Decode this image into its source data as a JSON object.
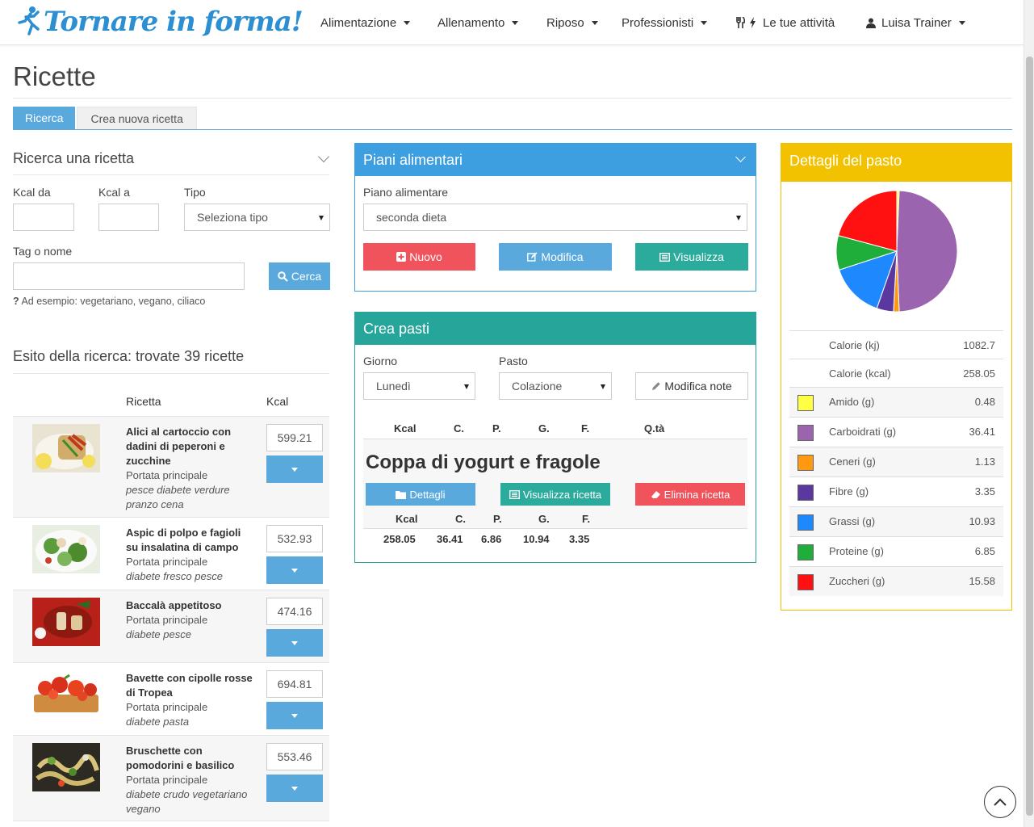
{
  "brand": {
    "name": "Tornare in forma!",
    "color": "#2b8fd2"
  },
  "nav": {
    "alimentazione": "Alimentazione",
    "allenamento": "Allenamento",
    "riposo": "Riposo",
    "professionisti": "Professionisti",
    "attivita": "Le tue attività",
    "user": "Luisa Trainer"
  },
  "page": {
    "title": "Ricette"
  },
  "tabs": {
    "search": "Ricerca",
    "create": "Crea nuova ricetta"
  },
  "search": {
    "heading": "Ricerca una ricetta",
    "kcal_from_label": "Kcal da",
    "kcal_to_label": "Kcal a",
    "type_label": "Tipo",
    "type_value": "Seleziona tipo",
    "tag_label": "Tag o nome",
    "search_button": "Cerca",
    "hint": "Ad esempio: vegetariano, vegano, ciliaco"
  },
  "results": {
    "heading": "Esito della ricerca: trovate 39 ricette",
    "col_recipe": "Ricetta",
    "col_kcal": "Kcal",
    "items": [
      {
        "title": "Alici al cartoccio con dadini di peperoni e zucchine",
        "course": "Portata principale",
        "tags": "pesce diabete verdure pranzo cena",
        "kcal": "599.21"
      },
      {
        "title": "Aspic di polpo e fagioli su insalatina di campo",
        "course": "Portata principale",
        "tags": "diabete fresco pesce",
        "kcal": "532.93"
      },
      {
        "title": "Baccalà appetitoso",
        "course": "Portata principale",
        "tags": "diabete pesce",
        "kcal": "474.16"
      },
      {
        "title": "Bavette con cipolle rosse di Tropea",
        "course": "Portata principale",
        "tags": "diabete pasta",
        "kcal": "694.81"
      },
      {
        "title": "Bruschette con pomodorini e basilico",
        "course": "Portata principale",
        "tags": "diabete crudo vegetariano vegano",
        "kcal": "553.46"
      }
    ]
  },
  "plans": {
    "heading": "Piani alimentari",
    "label": "Piano alimentare",
    "selected": "seconda dieta",
    "btn_new": "Nuovo",
    "btn_edit": "Modifica",
    "btn_view": "Visualizza",
    "color_head": "#3d9ee0"
  },
  "meals": {
    "heading": "Crea pasti",
    "day_label": "Giorno",
    "day_value": "Lunedì",
    "meal_label": "Pasto",
    "meal_value": "Colazione",
    "edit_notes": "Modifica note",
    "cols": [
      "Kcal",
      "C.",
      "P.",
      "G.",
      "F.",
      "Q.tà"
    ],
    "meal_name": "Coppa di yogurt e fragole",
    "btn_details": "Dettagli",
    "btn_view_recipe": "Visualizza ricetta",
    "btn_delete": "Elimina ricetta",
    "sub_cols": [
      "Kcal",
      "C.",
      "P.",
      "G.",
      "F."
    ],
    "values": [
      "258.05",
      "36.41",
      "6.86",
      "10.94",
      "3.35"
    ],
    "color_head": "#26a69a"
  },
  "details": {
    "heading": "Dettagli del pasto",
    "color_head": "#f2c200",
    "rows": [
      {
        "label": "Calorie (kj)",
        "value": "1082.7",
        "color": null
      },
      {
        "label": "Calorie (kcal)",
        "value": "258.05",
        "color": null
      },
      {
        "label": "Amido (g)",
        "value": "0.48",
        "color": "#ffff44"
      },
      {
        "label": "Carboidrati (g)",
        "value": "36.41",
        "color": "#9b64ae"
      },
      {
        "label": "Ceneri (g)",
        "value": "1.13",
        "color": "#ff9911"
      },
      {
        "label": "Fibre (g)",
        "value": "3.35",
        "color": "#5b37a0"
      },
      {
        "label": "Grassi (g)",
        "value": "10.93",
        "color": "#1e88ff"
      },
      {
        "label": "Proteine (g)",
        "value": "6.85",
        "color": "#1fae3a"
      },
      {
        "label": "Zuccheri (g)",
        "value": "15.58",
        "color": "#ff1111"
      }
    ]
  },
  "chart_data": {
    "type": "pie",
    "title": "",
    "categories": [
      "Amido (g)",
      "Carboidrati (g)",
      "Ceneri (g)",
      "Fibre (g)",
      "Grassi (g)",
      "Proteine (g)",
      "Zuccheri (g)"
    ],
    "values": [
      0.48,
      36.41,
      1.13,
      3.35,
      10.93,
      6.85,
      15.58
    ],
    "colors": [
      "#ffff44",
      "#9b64ae",
      "#ff9911",
      "#5b37a0",
      "#1e88ff",
      "#1fae3a",
      "#ff1111"
    ]
  }
}
